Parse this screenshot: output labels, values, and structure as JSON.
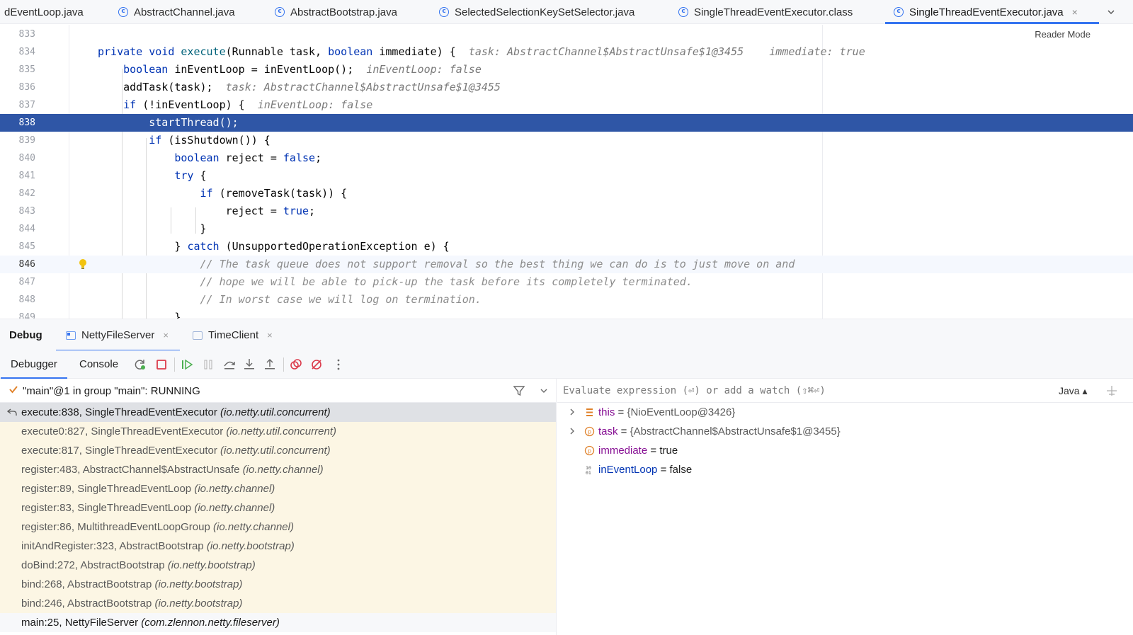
{
  "editor_tabs": [
    {
      "label": "dEventLoop.java",
      "icon": "none"
    },
    {
      "label": "AbstractChannel.java",
      "icon": "class-icon"
    },
    {
      "label": "AbstractBootstrap.java",
      "icon": "class-icon"
    },
    {
      "label": "SelectedSelectionKeySetSelector.java",
      "icon": "class-icon"
    },
    {
      "label": "SingleThreadEventExecutor.class",
      "icon": "class-icon"
    },
    {
      "label": "SingleThreadEventExecutor.java",
      "icon": "class-icon",
      "active": true
    }
  ],
  "tab_close_glyph": "×",
  "reader_mode": "Reader Mode",
  "code_lines": [
    {
      "num": "833"
    },
    {
      "num": "834",
      "hint1": "task: AbstractChannel$AbstractUnsafe$1@3455",
      "hint2": "immediate: true"
    },
    {
      "num": "835",
      "hint": "inEventLoop: false"
    },
    {
      "num": "836",
      "hint": "task: AbstractChannel$AbstractUnsafe$1@3455"
    },
    {
      "num": "837",
      "hint": "inEventLoop: false"
    },
    {
      "num": "838",
      "text": "startThread();"
    },
    {
      "num": "839"
    },
    {
      "num": "840"
    },
    {
      "num": "841"
    },
    {
      "num": "842"
    },
    {
      "num": "843"
    },
    {
      "num": "844"
    },
    {
      "num": "845"
    },
    {
      "num": "846",
      "text": "// The task queue does not support removal so the best thing we can do is to just move on and"
    },
    {
      "num": "847",
      "text": "// hope we will be able to pick-up the task before its completely terminated."
    },
    {
      "num": "848",
      "text": "// In worst case we will log on termination."
    },
    {
      "num": "849"
    }
  ],
  "debug": {
    "title": "Debug",
    "sessions": [
      {
        "label": "NettyFileServer",
        "active": true
      },
      {
        "label": "TimeClient"
      }
    ],
    "subtabs": [
      "Debugger",
      "Console"
    ],
    "thread": "\"main\"@1 in group \"main\": RUNNING",
    "frames": [
      {
        "method": "execute:838, SingleThreadEventExecutor",
        "pkg": "(io.netty.util.concurrent)",
        "state": "selected"
      },
      {
        "method": "execute0:827, SingleThreadEventExecutor",
        "pkg": "(io.netty.util.concurrent)"
      },
      {
        "method": "execute:817, SingleThreadEventExecutor",
        "pkg": "(io.netty.util.concurrent)"
      },
      {
        "method": "register:483, AbstractChannel$AbstractUnsafe",
        "pkg": "(io.netty.channel)"
      },
      {
        "method": "register:89, SingleThreadEventLoop",
        "pkg": "(io.netty.channel)"
      },
      {
        "method": "register:83, SingleThreadEventLoop",
        "pkg": "(io.netty.channel)"
      },
      {
        "method": "register:86, MultithreadEventLoopGroup",
        "pkg": "(io.netty.channel)"
      },
      {
        "method": "initAndRegister:323, AbstractBootstrap",
        "pkg": "(io.netty.bootstrap)"
      },
      {
        "method": "doBind:272, AbstractBootstrap",
        "pkg": "(io.netty.bootstrap)"
      },
      {
        "method": "bind:268, AbstractBootstrap",
        "pkg": "(io.netty.bootstrap)"
      },
      {
        "method": "bind:246, AbstractBootstrap",
        "pkg": "(io.netty.bootstrap)"
      },
      {
        "method": "main:25, NettyFileServer",
        "pkg": "(com.zlennon.netty.fileserver)",
        "state": "plain"
      }
    ],
    "evaluate_placeholder": "Evaluate expression (⏎) or add a watch (⇧⌘⏎)",
    "language": "Java ▴",
    "variables": [
      {
        "name": "this",
        "value": "{NioEventLoop@3426}",
        "expandable": true,
        "icon": "field-icon"
      },
      {
        "name": "task",
        "value": "{AbstractChannel$AbstractUnsafe$1@3455}",
        "expandable": true,
        "icon": "parameter-icon"
      },
      {
        "name": "immediate",
        "value": "true",
        "expandable": false,
        "icon": "parameter-icon"
      },
      {
        "name": "inEventLoop",
        "value": "false",
        "expandable": false,
        "icon": "local-variable-icon"
      }
    ]
  },
  "colors": {
    "accent": "#3574f0",
    "execution_line": "#2f56a6",
    "frame_bg": "#fcf6e4",
    "keyword": "#0033b3"
  }
}
